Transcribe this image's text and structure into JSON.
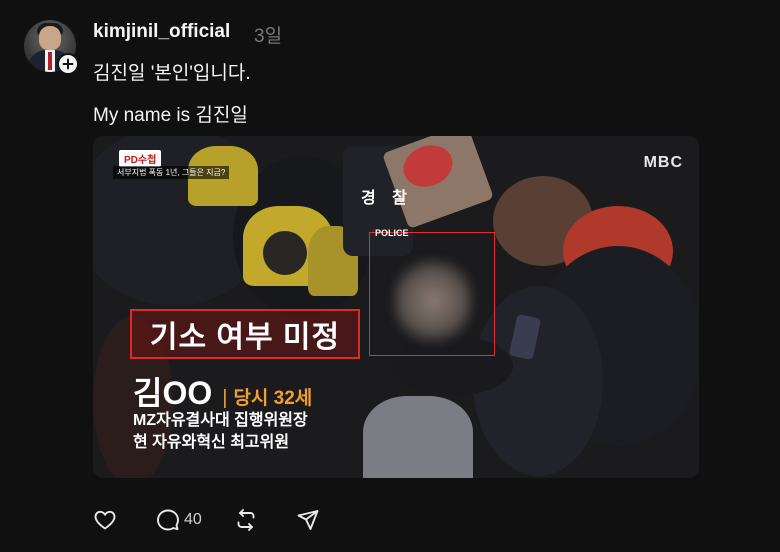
{
  "post": {
    "username": "kimjinil_official",
    "timestamp": "3일",
    "text_line1": "김진일 '본인'입니다.",
    "text_line2": "My name is 김진일"
  },
  "media": {
    "pd_badge": "PD수첩",
    "pd_subtitle": "서부지법 폭동 1년, 그들은 지금?",
    "broadcaster": "MBC",
    "police_sign": "경 찰",
    "police_label": "POLICE",
    "caption": "기소 여부 미정",
    "person_name": "김OO",
    "person_age": "당시 32세",
    "role_line1": "MZ자유결사대 집행위원장",
    "role_line2": "현 자유와혁신 최고위원"
  },
  "actions": {
    "like_icon": "heart-icon",
    "comment_icon": "comment-icon",
    "comment_count": "40",
    "repost_icon": "repost-icon",
    "share_icon": "send-icon"
  },
  "colors": {
    "background": "#101010",
    "text_primary": "#f3f5f7",
    "text_secondary": "#777777",
    "caption_red": "#e02a2a",
    "age_orange": "#f0a030"
  }
}
